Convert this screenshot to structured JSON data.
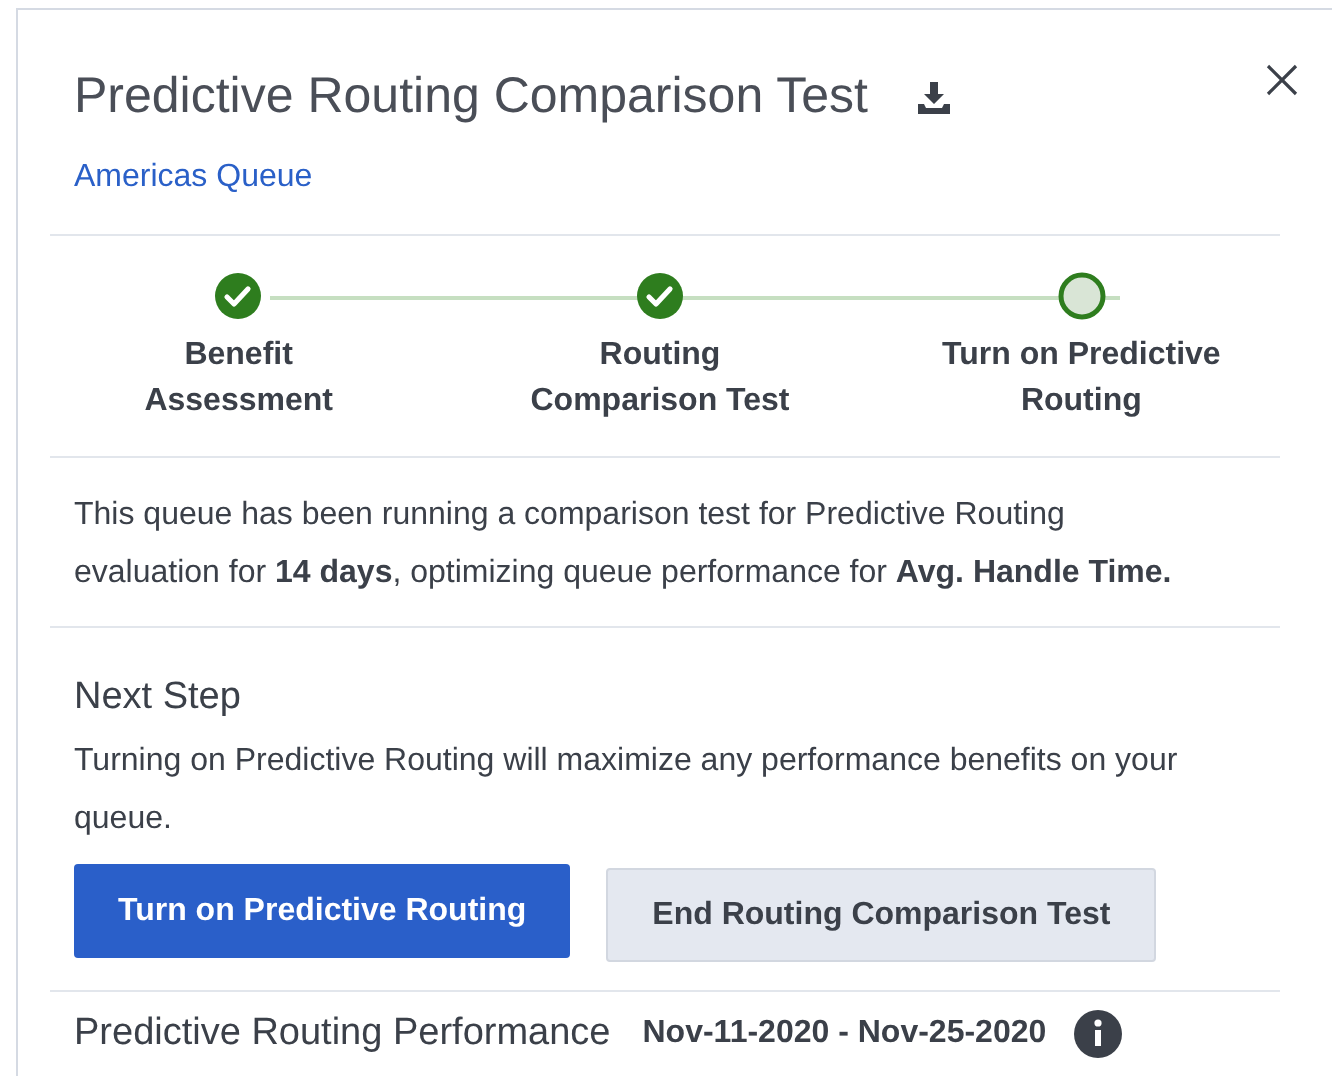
{
  "panel": {
    "title": "Predictive Routing Comparison Test",
    "queue_link": "Americas Queue"
  },
  "steps": [
    {
      "label": "Benefit Assessment",
      "completed": true
    },
    {
      "label": "Routing Comparison Test",
      "completed": true
    },
    {
      "label": "Turn on Predictive Routing",
      "completed": false
    }
  ],
  "summary": "This queue has been running a comparison test for Predictive Routing evaluation for **14 days**, optimizing queue performance for **Avg. Handle Time.**",
  "next_step": {
    "heading": "Next Step",
    "text": "Turning on Predictive Routing will maximize any performance benefits on your queue.",
    "buttons": [
      {
        "label": "Turn on Predictive Routing",
        "kind": "primary"
      },
      {
        "label": "End Routing Comparison Test",
        "kind": "secondary"
      }
    ]
  },
  "performance": {
    "heading": "Predictive Routing Performance",
    "date_range": "Nov-11-2020 - Nov-25-2020"
  }
}
